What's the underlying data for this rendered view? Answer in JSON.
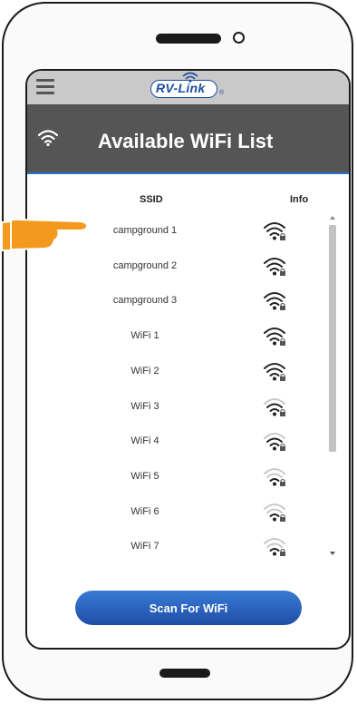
{
  "app": {
    "logo_text": "RV-Link",
    "menu_icon": "hamburger-icon"
  },
  "header": {
    "title": "Available WiFi List",
    "icon": "wifi-icon"
  },
  "table": {
    "columns": [
      "SSID",
      "Info"
    ],
    "rows": [
      {
        "ssid": "campground 1",
        "signal_bars": 4
      },
      {
        "ssid": "campground 2",
        "signal_bars": 4
      },
      {
        "ssid": "campground 3",
        "signal_bars": 4
      },
      {
        "ssid": "WiFi 1",
        "signal_bars": 4
      },
      {
        "ssid": "WiFi 2",
        "signal_bars": 4
      },
      {
        "ssid": "WiFi 3",
        "signal_bars": 3
      },
      {
        "ssid": "WiFi 4",
        "signal_bars": 3
      },
      {
        "ssid": "WiFi 5",
        "signal_bars": 2
      },
      {
        "ssid": "WiFi 6",
        "signal_bars": 2
      },
      {
        "ssid": "WiFi 7",
        "signal_bars": 2
      }
    ]
  },
  "scan_button": {
    "label": "Scan For WiFi"
  },
  "colors": {
    "header_bg": "#555555",
    "accent_blue": "#2a6fc9",
    "button_blue": "#1e4ea6",
    "pointer_orange": "#f39a1e"
  }
}
